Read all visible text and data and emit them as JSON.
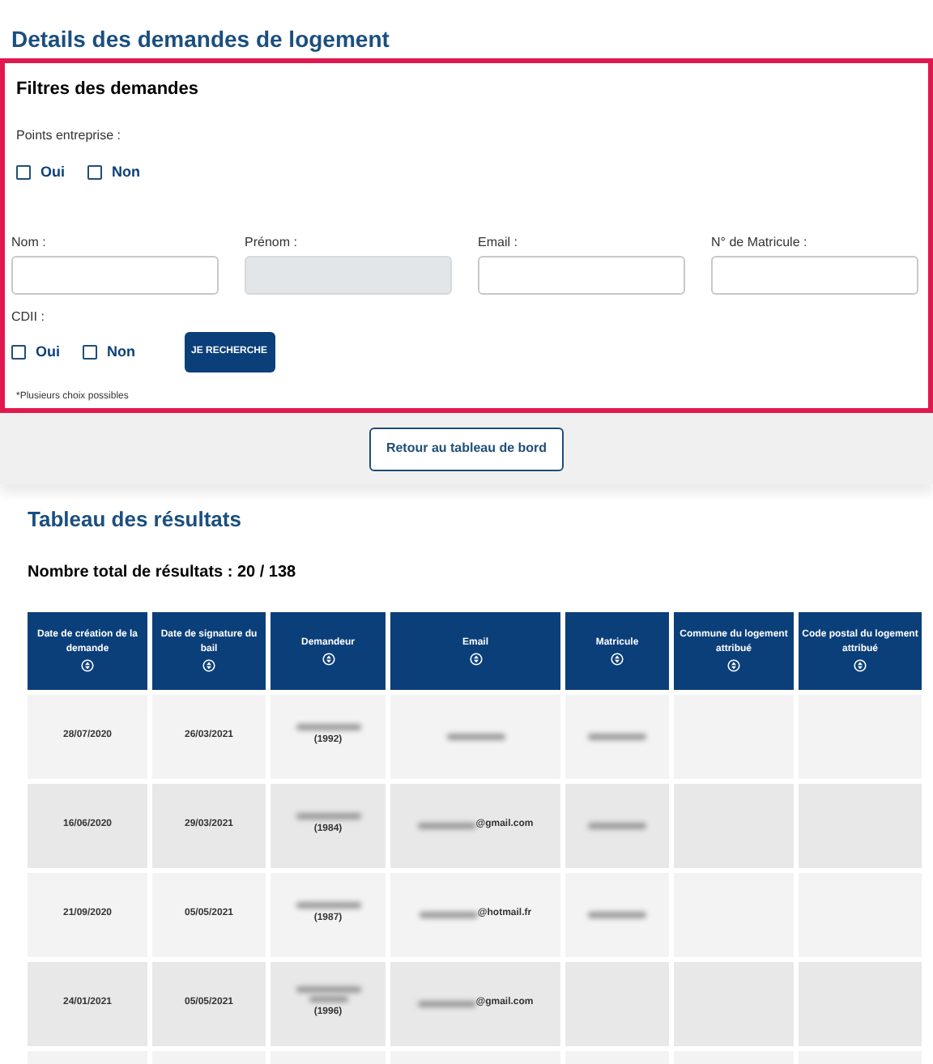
{
  "page_title": "Details des demandes de logement",
  "filters": {
    "title": "Filtres des demandes",
    "points_label": "Points entreprise :",
    "points_options": [
      {
        "label": "Oui",
        "checked": false
      },
      {
        "label": "Non",
        "checked": false
      }
    ],
    "fields": [
      {
        "label": "Nom :",
        "disabled": false
      },
      {
        "label": "Prénom :",
        "disabled": true
      },
      {
        "label": "Email :",
        "disabled": false
      },
      {
        "label": "N° de Matricule :",
        "disabled": false
      }
    ],
    "cdii_label": "CDII :",
    "cdii_options": [
      {
        "label": "Oui",
        "checked": false
      },
      {
        "label": "Non",
        "checked": false
      }
    ],
    "search_button": "JE RECHERCHE",
    "note": "*Plusieurs choix possibles"
  },
  "back_button": "Retour au tableau de bord",
  "results": {
    "title": "Tableau des résultats",
    "total": "Nombre total de résultats : 20 / 138",
    "columns": [
      "Date de création de la demande",
      "Date de signature du bail",
      "Demandeur",
      "Email",
      "Matricule",
      "Commune du logement attribué",
      "Code postal du logement attribué"
    ],
    "rows": [
      {
        "cells": [
          {
            "text": "28/07/2020",
            "kind": "plain"
          },
          {
            "text": "26/03/2021",
            "kind": "plain"
          },
          {
            "text": "(1992)",
            "kind": "blurline"
          },
          {
            "kind": "blurred"
          },
          {
            "kind": "blurred"
          },
          {
            "kind": "plain"
          },
          {
            "kind": "plain"
          }
        ]
      },
      {
        "cells": [
          {
            "text": "16/06/2020",
            "kind": "plain"
          },
          {
            "text": "29/03/2021",
            "kind": "plain"
          },
          {
            "text": "(1984)",
            "kind": "blurline"
          },
          {
            "text": "@gmail.com",
            "kind": "blurprefix"
          },
          {
            "kind": "blurred"
          },
          {
            "kind": "plain"
          },
          {
            "kind": "plain"
          }
        ]
      },
      {
        "cells": [
          {
            "text": "21/09/2020",
            "kind": "plain"
          },
          {
            "text": "05/05/2021",
            "kind": "plain"
          },
          {
            "text": "(1987)",
            "kind": "blurline"
          },
          {
            "text": "@hotmail.fr",
            "kind": "blurprefix"
          },
          {
            "kind": "blurred"
          },
          {
            "kind": "plain"
          },
          {
            "kind": "plain"
          }
        ]
      },
      {
        "cells": [
          {
            "text": "24/01/2021",
            "kind": "plain"
          },
          {
            "text": "05/05/2021",
            "kind": "plain"
          },
          {
            "text": "(1996)",
            "kind": "blurlines"
          },
          {
            "text": "@gmail.com",
            "kind": "blurprefix"
          },
          {
            "kind": "plain"
          },
          {
            "kind": "plain"
          },
          {
            "kind": "plain"
          }
        ]
      }
    ]
  }
}
